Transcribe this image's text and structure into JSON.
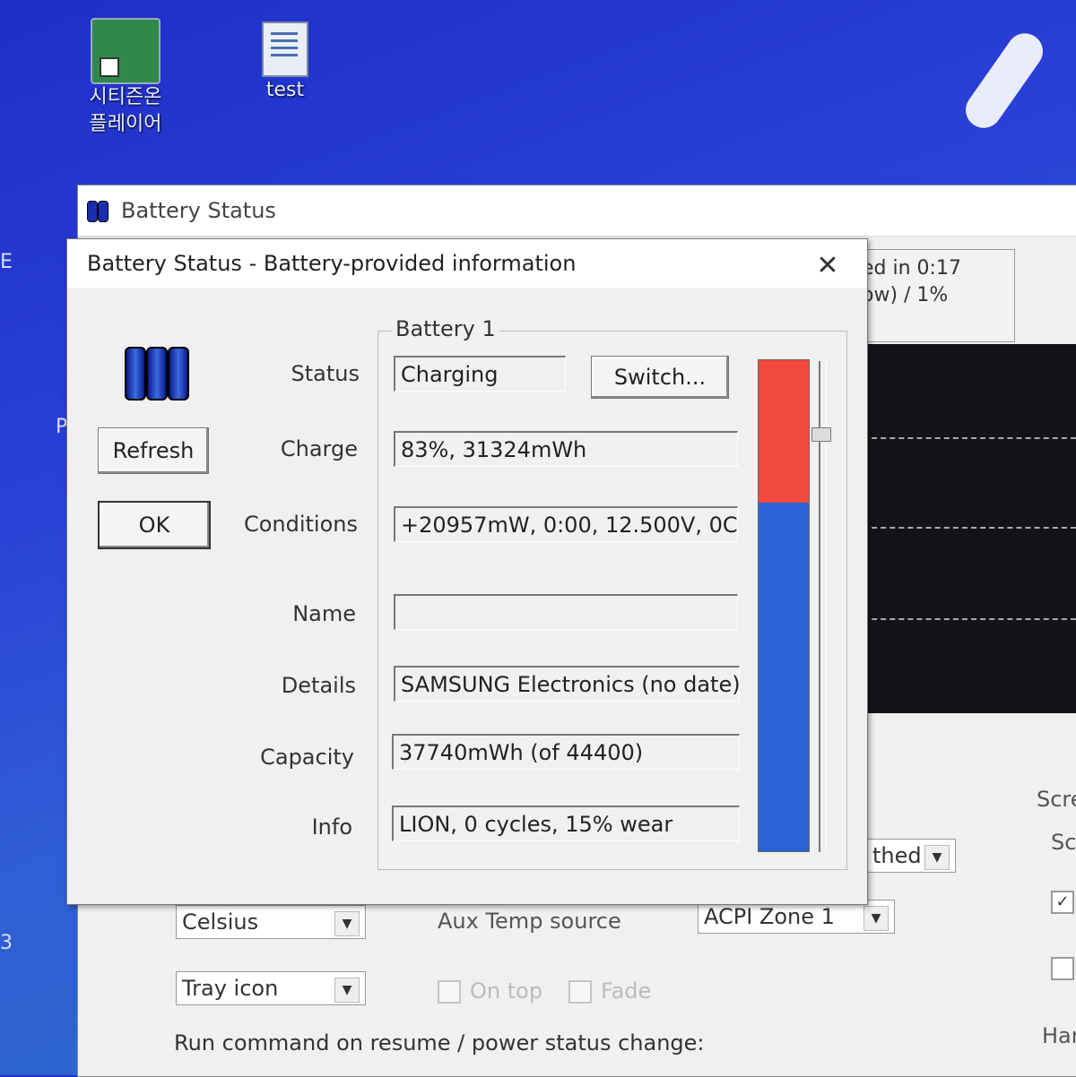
{
  "desktop": {
    "icons": [
      {
        "label_line1": "시티즌온",
        "label_line2": "플레이어",
        "icon": "media-player-shortcut-icon"
      },
      {
        "label_line1": "test",
        "label_line2": "",
        "icon": "document-icon"
      }
    ],
    "left_edge_chars": [
      "E",
      "P",
      "3"
    ]
  },
  "main_window": {
    "title": "Battery Status",
    "status_line1": "ed in 0:17",
    "status_line2": "ow) / 1%",
    "dropdown_matched": "thed",
    "temp_unit": "Celsius",
    "aux_temp_label": "Aux Temp source",
    "aux_temp_value": "ACPI Zone 1",
    "display_mode": "Tray icon",
    "on_top_label": "On top",
    "fade_label": "Fade",
    "run_command_label": "Run command on resume / power status change:",
    "right_label_scr": "Scre",
    "right_label_sc": "Sc",
    "right_label_har": "Har"
  },
  "dialog": {
    "title": "Battery Status - Battery-provided information",
    "close_icon": "close-icon",
    "buttons": {
      "refresh": "Refresh",
      "ok": "OK",
      "switch": "Switch..."
    },
    "group_label": "Battery 1",
    "fields": {
      "status": {
        "label": "Status",
        "value": "Charging"
      },
      "charge": {
        "label": "Charge",
        "value": "83%, 31324mWh"
      },
      "conditions": {
        "label": "Conditions",
        "value": "+20957mW, 0:00, 12.500V, 0C"
      },
      "name": {
        "label": "Name",
        "value": ""
      },
      "details": {
        "label": "Details",
        "value": "SAMSUNG Electronics (no date)"
      },
      "capacity": {
        "label": "Capacity",
        "value": "37740mWh (of 44400)"
      },
      "info": {
        "label": "Info",
        "value": "LION, 0 cycles, 15% wear"
      }
    },
    "charge_level_fraction": 0.71,
    "colors": {
      "level_fill": "#2a62d6",
      "empty_fill": "#f24a3e"
    }
  }
}
